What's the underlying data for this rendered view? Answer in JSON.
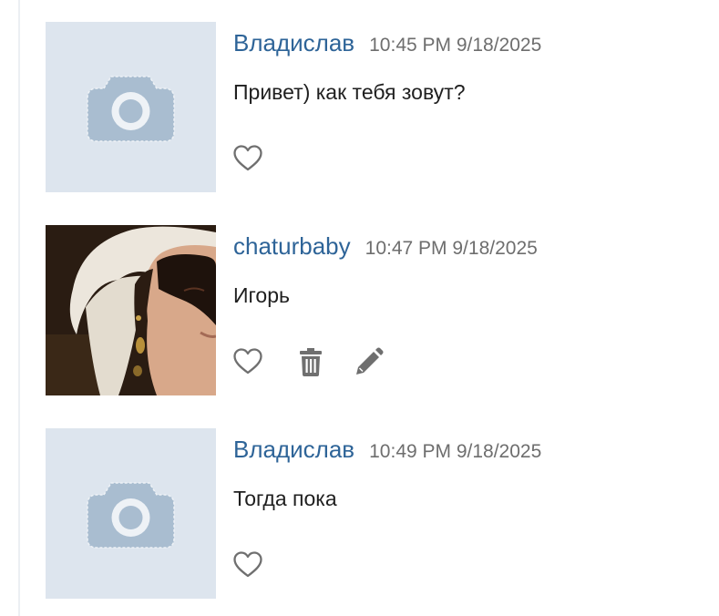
{
  "messages": [
    {
      "author": "Владислав",
      "time": "10:45 PM 9/18/2025",
      "text": "Привет) как тебя зовут?",
      "avatar": "camera-placeholder-icon",
      "actions": [
        "heart-icon"
      ]
    },
    {
      "author": "chaturbaby",
      "time": "10:47 PM 9/18/2025",
      "text": "Игорь",
      "avatar": "user-photo",
      "actions": [
        "heart-icon",
        "trash-icon",
        "pencil-icon"
      ]
    },
    {
      "author": "Владислав",
      "time": "10:49 PM 9/18/2025",
      "text": "Тогда пока",
      "avatar": "camera-placeholder-icon",
      "actions": [
        "heart-icon"
      ]
    }
  ],
  "colors": {
    "author": "#2e6498",
    "timestamp": "#6e6e6e",
    "text": "#1f1f1f",
    "icon": "#6f6f6f",
    "placeholder_bg": "#dde5ee",
    "placeholder_icon": "#a9bdd0"
  }
}
